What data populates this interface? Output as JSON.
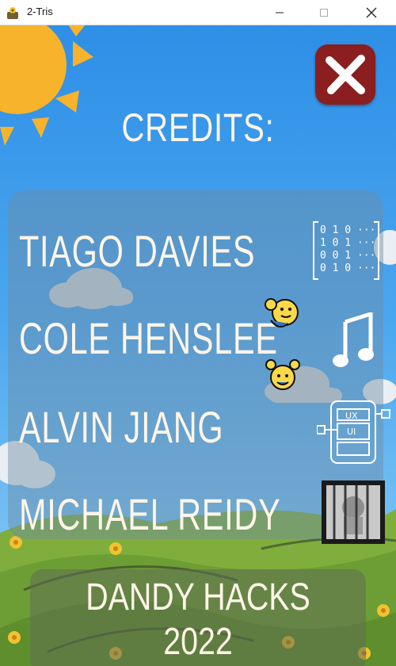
{
  "window": {
    "title": "2-Tris",
    "minimize_glyph": "—",
    "maximize_glyph": "□",
    "close_glyph": "✕"
  },
  "screen": {
    "heading": "CREDITS:",
    "close_icon": "close-x-icon",
    "credits": [
      {
        "name": "TIAGO DAVIES",
        "icon": "binary-code-icon"
      },
      {
        "name": "COLE HENSLEE",
        "icon": "music-note-icon"
      },
      {
        "name": "ALVIN JIANG",
        "icon": "ux-ui-tablet-icon"
      },
      {
        "name": "MICHAEL REIDY",
        "icon": "caged-character-art-icon"
      }
    ],
    "footer": {
      "line1": "DANDY HACKS",
      "line2": "2022"
    }
  },
  "colors": {
    "sky_top": "#2e8fe6",
    "text_cream": "#fff5e8",
    "close_button": "#8b1e1e",
    "sun": "#f7b32b",
    "grass": "#7fae3c"
  }
}
